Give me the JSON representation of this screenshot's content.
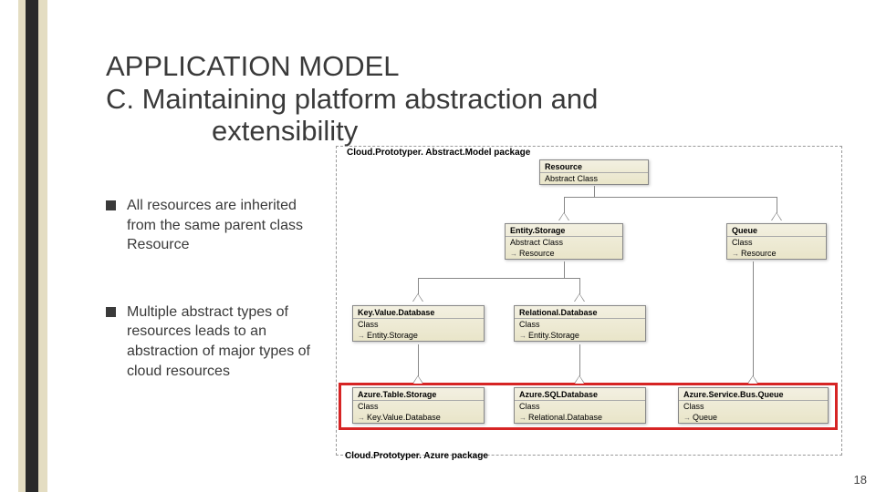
{
  "title": {
    "line1": "APPLICATION MODEL",
    "line2": "C. Maintaining platform abstraction and",
    "line3": "extensibility"
  },
  "bullets": [
    "All resources are inherited from the same parent class Resource",
    "Multiple abstract types of resources leads to an abstraction of major types of cloud resources"
  ],
  "diagram": {
    "package_top": "Cloud.Prototyper. Abstract.Model package",
    "package_bottom": "Cloud.Prototyper. Azure package",
    "nodes": {
      "resource": {
        "name": "Resource",
        "meta": "Abstract Class"
      },
      "entitystorage": {
        "name": "Entity.Storage",
        "meta": "Abstract Class",
        "parent": "Resource"
      },
      "queue": {
        "name": "Queue",
        "meta": "Class",
        "parent": "Resource"
      },
      "keyvalue": {
        "name": "Key.Value.Database",
        "meta": "Class",
        "parent": "Entity.Storage"
      },
      "relational": {
        "name": "Relational.Database",
        "meta": "Class",
        "parent": "Entity.Storage"
      },
      "aztable": {
        "name": "Azure.Table.Storage",
        "meta": "Class",
        "parent": "Key.Value.Database"
      },
      "azsql": {
        "name": "Azure.SQLDatabase",
        "meta": "Class",
        "parent": "Relational.Database"
      },
      "azbus": {
        "name": "Azure.Service.Bus.Queue",
        "meta": "Class",
        "parent": "Queue"
      }
    }
  },
  "page_number": "18"
}
